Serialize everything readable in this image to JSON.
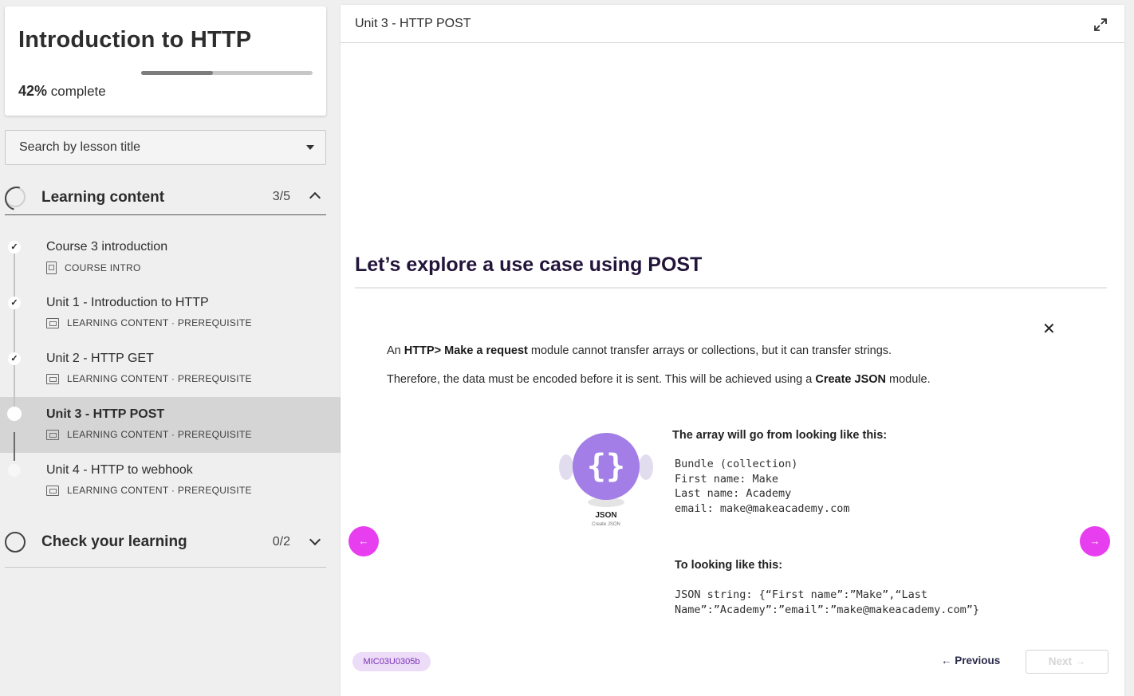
{
  "course": {
    "title": "Introduction to HTTP",
    "progress_percent": 42,
    "progress_value": "42%",
    "progress_suffix": " complete"
  },
  "search": {
    "placeholder": "Search by lesson title"
  },
  "sections": [
    {
      "title": "Learning content",
      "count": "3/5",
      "expanded": true
    },
    {
      "title": "Check your learning",
      "count": "0/2",
      "expanded": false
    }
  ],
  "lessons": [
    {
      "title": "Course 3 introduction",
      "meta": "COURSE INTRO",
      "status": "done",
      "icon": "document-icon"
    },
    {
      "title": "Unit 1 - Introduction to HTTP",
      "meta": "LEARNING CONTENT · PREREQUISITE",
      "status": "done",
      "icon": "slides-icon"
    },
    {
      "title": "Unit 2 - HTTP GET",
      "meta": "LEARNING CONTENT · PREREQUISITE",
      "status": "done",
      "icon": "slides-icon"
    },
    {
      "title": "Unit 3 - HTTP POST",
      "meta": "LEARNING CONTENT · PREREQUISITE",
      "status": "current",
      "icon": "slides-icon"
    },
    {
      "title": "Unit 4 - HTTP to webhook",
      "meta": "LEARNING CONTENT · PREREQUISITE",
      "status": "todo",
      "icon": "slides-icon"
    }
  ],
  "main": {
    "header_title": "Unit 3 - HTTP POST",
    "slide_title": "Let’s explore a use case using POST",
    "para1": {
      "a": "An ",
      "b1": "HTTP> Make a request",
      "c": " module cannot transfer arrays or collections, but it can transfer strings."
    },
    "para2": {
      "a": "Therefore, the data must be encoded before it is sent. This will be achieved using a ",
      "b1": "Create JSON",
      "c": " module."
    },
    "json_module": {
      "glyph": "{}",
      "label": "JSON",
      "sublabel": "Create JSON"
    },
    "from_heading": "The array will go from looking like this:",
    "from_code": "Bundle (collection)\nFirst name: Make\nLast name: Academy\nemail: make@makeacademy.com",
    "to_heading": "To looking like this:",
    "to_code": "JSON string: {“First name”:”Make”,“Last\nName”:”Academy”:”email”:”make@makeacademy.com”}",
    "badge": "MIC03U0305b",
    "previous_label": "Previous",
    "next_label": "Next"
  },
  "colors": {
    "accent_magenta": "#e73ef0",
    "json_purple": "#a37ee6",
    "badge_bg": "#ecdcf8",
    "title_dark": "#22143a"
  }
}
